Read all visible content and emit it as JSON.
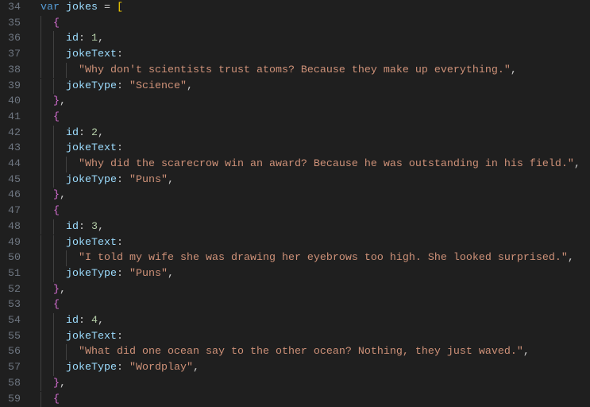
{
  "editor": {
    "colors": {
      "background": "#1f1f1f",
      "keyword": "#569cd6",
      "variable": "#9cdcfe",
      "number": "#b5cea8",
      "string": "#ce9178",
      "bracket1": "#ffd700",
      "bracket2": "#da70d6"
    },
    "lines": [
      {
        "n": "34",
        "tokens": [
          [
            "kw",
            "var"
          ],
          [
            "p",
            " "
          ],
          [
            "var",
            "jokes"
          ],
          [
            "p",
            " = "
          ],
          [
            "b1",
            "["
          ]
        ]
      },
      {
        "n": "35",
        "tokens": [
          [
            "p",
            "  "
          ],
          [
            "b2",
            "{"
          ]
        ]
      },
      {
        "n": "36",
        "tokens": [
          [
            "p",
            "    "
          ],
          [
            "prop",
            "id"
          ],
          [
            "p",
            ": "
          ],
          [
            "num",
            "1"
          ],
          [
            "p",
            ","
          ]
        ]
      },
      {
        "n": "37",
        "tokens": [
          [
            "p",
            "    "
          ],
          [
            "prop",
            "jokeText"
          ],
          [
            "p",
            ":"
          ]
        ]
      },
      {
        "n": "38",
        "tokens": [
          [
            "p",
            "      "
          ],
          [
            "str",
            "\"Why don't scientists trust atoms? Because they make up everything.\""
          ],
          [
            "p",
            ","
          ]
        ]
      },
      {
        "n": "39",
        "tokens": [
          [
            "p",
            "    "
          ],
          [
            "prop",
            "jokeType"
          ],
          [
            "p",
            ": "
          ],
          [
            "str",
            "\"Science\""
          ],
          [
            "p",
            ","
          ]
        ]
      },
      {
        "n": "40",
        "tokens": [
          [
            "p",
            "  "
          ],
          [
            "b2",
            "}"
          ],
          [
            "p",
            ","
          ]
        ]
      },
      {
        "n": "41",
        "tokens": [
          [
            "p",
            "  "
          ],
          [
            "b2",
            "{"
          ]
        ]
      },
      {
        "n": "42",
        "tokens": [
          [
            "p",
            "    "
          ],
          [
            "prop",
            "id"
          ],
          [
            "p",
            ": "
          ],
          [
            "num",
            "2"
          ],
          [
            "p",
            ","
          ]
        ]
      },
      {
        "n": "43",
        "tokens": [
          [
            "p",
            "    "
          ],
          [
            "prop",
            "jokeText"
          ],
          [
            "p",
            ":"
          ]
        ]
      },
      {
        "n": "44",
        "tokens": [
          [
            "p",
            "      "
          ],
          [
            "str",
            "\"Why did the scarecrow win an award? Because he was outstanding in his field.\""
          ],
          [
            "p",
            ","
          ]
        ]
      },
      {
        "n": "45",
        "tokens": [
          [
            "p",
            "    "
          ],
          [
            "prop",
            "jokeType"
          ],
          [
            "p",
            ": "
          ],
          [
            "str",
            "\"Puns\""
          ],
          [
            "p",
            ","
          ]
        ]
      },
      {
        "n": "46",
        "tokens": [
          [
            "p",
            "  "
          ],
          [
            "b2",
            "}"
          ],
          [
            "p",
            ","
          ]
        ]
      },
      {
        "n": "47",
        "tokens": [
          [
            "p",
            "  "
          ],
          [
            "b2",
            "{"
          ]
        ]
      },
      {
        "n": "48",
        "tokens": [
          [
            "p",
            "    "
          ],
          [
            "prop",
            "id"
          ],
          [
            "p",
            ": "
          ],
          [
            "num",
            "3"
          ],
          [
            "p",
            ","
          ]
        ]
      },
      {
        "n": "49",
        "tokens": [
          [
            "p",
            "    "
          ],
          [
            "prop",
            "jokeText"
          ],
          [
            "p",
            ":"
          ]
        ]
      },
      {
        "n": "50",
        "tokens": [
          [
            "p",
            "      "
          ],
          [
            "str",
            "\"I told my wife she was drawing her eyebrows too high. She looked surprised.\""
          ],
          [
            "p",
            ","
          ]
        ]
      },
      {
        "n": "51",
        "tokens": [
          [
            "p",
            "    "
          ],
          [
            "prop",
            "jokeType"
          ],
          [
            "p",
            ": "
          ],
          [
            "str",
            "\"Puns\""
          ],
          [
            "p",
            ","
          ]
        ]
      },
      {
        "n": "52",
        "tokens": [
          [
            "p",
            "  "
          ],
          [
            "b2",
            "}"
          ],
          [
            "p",
            ","
          ]
        ]
      },
      {
        "n": "53",
        "tokens": [
          [
            "p",
            "  "
          ],
          [
            "b2",
            "{"
          ]
        ]
      },
      {
        "n": "54",
        "tokens": [
          [
            "p",
            "    "
          ],
          [
            "prop",
            "id"
          ],
          [
            "p",
            ": "
          ],
          [
            "num",
            "4"
          ],
          [
            "p",
            ","
          ]
        ]
      },
      {
        "n": "55",
        "tokens": [
          [
            "p",
            "    "
          ],
          [
            "prop",
            "jokeText"
          ],
          [
            "p",
            ":"
          ]
        ]
      },
      {
        "n": "56",
        "tokens": [
          [
            "p",
            "      "
          ],
          [
            "str",
            "\"What did one ocean say to the other ocean? Nothing, they just waved.\""
          ],
          [
            "p",
            ","
          ]
        ]
      },
      {
        "n": "57",
        "tokens": [
          [
            "p",
            "    "
          ],
          [
            "prop",
            "jokeType"
          ],
          [
            "p",
            ": "
          ],
          [
            "str",
            "\"Wordplay\""
          ],
          [
            "p",
            ","
          ]
        ]
      },
      {
        "n": "58",
        "tokens": [
          [
            "p",
            "  "
          ],
          [
            "b2",
            "}"
          ],
          [
            "p",
            ","
          ]
        ]
      },
      {
        "n": "59",
        "tokens": [
          [
            "p",
            "  "
          ],
          [
            "b2",
            "{"
          ]
        ]
      }
    ]
  }
}
